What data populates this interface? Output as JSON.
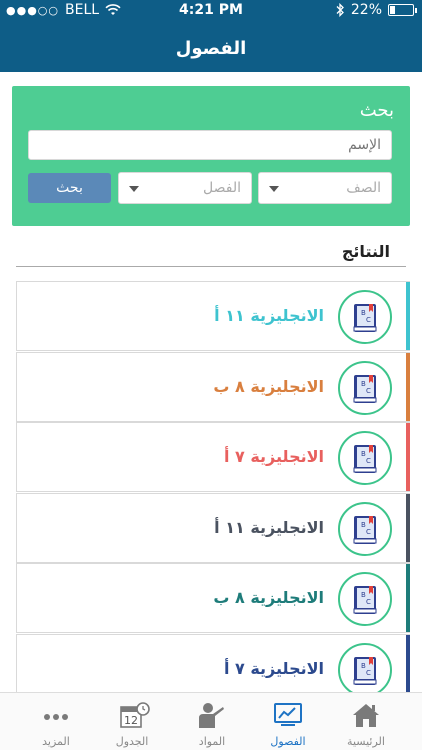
{
  "status_bar": {
    "carrier": "BELL",
    "signal_dots": "●●●○○",
    "time": "4:21 PM",
    "battery": "22%",
    "battery_level": 0.22
  },
  "nav": {
    "title": "الفصول"
  },
  "search": {
    "title": "بحث",
    "name_placeholder": "الإسم",
    "grade_label": "الصف",
    "class_label": "الفصل",
    "button_label": "بحث"
  },
  "results": {
    "title": "النتائج",
    "items": [
      {
        "name": "الانجليزية ١١ أ",
        "color": "#3ec3cf"
      },
      {
        "name": "الانجليزية ٨ ب",
        "color": "#d97f3e"
      },
      {
        "name": "الانجليزية ٧ أ",
        "color": "#e8605e"
      },
      {
        "name": "الانجليزية ١١ أ",
        "color": "#4a5260"
      },
      {
        "name": "الانجليزية ٨ ب",
        "color": "#1e7c7a"
      },
      {
        "name": "الانجليزية ٧ أ",
        "color": "#2c4a8e"
      }
    ],
    "book_letters": [
      "B",
      "C"
    ]
  },
  "tabbar": {
    "tabs": [
      {
        "label": "الرئيسية",
        "icon": "home-icon",
        "active": false
      },
      {
        "label": "الفصول",
        "icon": "classes-icon",
        "active": true
      },
      {
        "label": "المواد",
        "icon": "subjects-icon",
        "active": false
      },
      {
        "label": "الجدول",
        "icon": "calendar-icon",
        "active": false
      },
      {
        "label": "المزيد",
        "icon": "more-icon",
        "active": false
      }
    ],
    "calendar_day": "12"
  },
  "colors": {
    "header": "#0e5d87",
    "search_panel": "#4ecd93",
    "search_button": "#5b89b8",
    "active_tab": "#1e73c4",
    "circle_border": "#3cc48b"
  }
}
